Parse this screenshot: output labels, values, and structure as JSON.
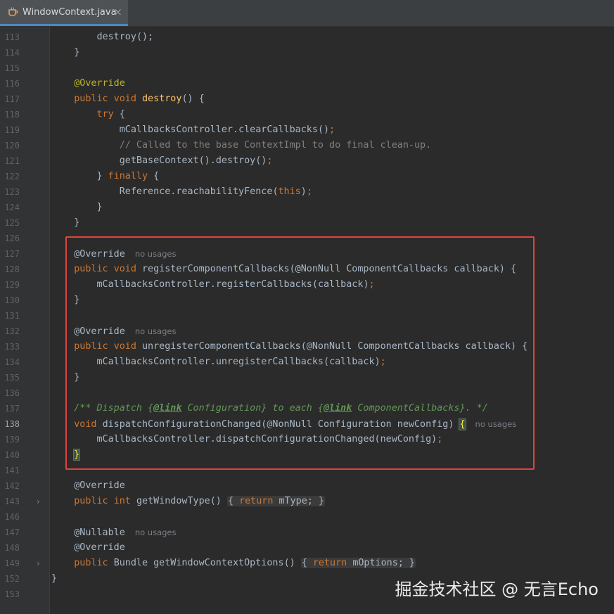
{
  "tab": {
    "title": "WindowContext.java",
    "close": "×"
  },
  "watermark": "掘金技术社区 @ 无言Echo",
  "hint_text": "no usages",
  "line_numbers": {
    "l113": "113",
    "l114": "114",
    "l115": "115",
    "l116": "116",
    "l117": "117",
    "l118": "118",
    "l119": "119",
    "l120": "120",
    "l121": "121",
    "l122": "122",
    "l123": "123",
    "l124": "124",
    "l125": "125",
    "l126": "126",
    "l127": "127",
    "l128": "128",
    "l129": "129",
    "l130": "130",
    "l131": "131",
    "l132": "132",
    "l133": "133",
    "l134": "134",
    "l135": "135",
    "l136": "136",
    "l137": "137",
    "l138": "138",
    "l139": "139",
    "l140": "140",
    "l141": "141",
    "l142": "142",
    "l143": "143",
    "l146": "146",
    "l147": "147",
    "l148": "148",
    "l149": "149",
    "l152": "152",
    "l153": "153"
  },
  "current_line": "138",
  "tokens": {
    "destroy_call": "destroy",
    "override": "@Override",
    "nullable": "@Nullable",
    "nonnull": "@NonNull",
    "public": "public",
    "void": "void",
    "int": "int",
    "try": "try",
    "finally": "finally",
    "return": "return",
    "this": "this",
    "destroy": "destroy",
    "mCallbacksController": "mCallbacksController",
    "clearCallbacks": "clearCallbacks",
    "comment_120": "// Called to the base ContextImpl to do final clean-up.",
    "getBaseContext": "getBaseContext",
    "Reference": "Reference",
    "reachabilityFence": "reachabilityFence",
    "registerComponentCallbacks": "registerComponentCallbacks",
    "unregisterComponentCallbacks": "unregisterComponentCallbacks",
    "ComponentCallbacks": "ComponentCallbacks",
    "callback": "callback",
    "registerCallbacks": "registerCallbacks",
    "unregisterCallbacks": "unregisterCallbacks",
    "doc_open": "/** Dispatch {",
    "doc_link": "@link",
    "doc_mid1": " Configuration} to each {",
    "doc_mid2": " ComponentCallbacks}. */",
    "dispatchConfigurationChanged": "dispatchConfigurationChanged",
    "Configuration": "Configuration",
    "newConfig": "newConfig",
    "getWindowType": "getWindowType",
    "mType": "mType",
    "Bundle": "Bundle",
    "getWindowContextOptions": "getWindowContextOptions",
    "mOptions": "mOptions"
  },
  "colors": {
    "background": "#2b2b2b",
    "keyword": "#cc7832",
    "annotation": "#bbb529",
    "method_decl": "#ffc66d",
    "comment": "#808080",
    "javadoc": "#629755",
    "highlight_box": "#e0443f"
  },
  "icons": {
    "tab_icon": "java-cup-icon",
    "fold_icon": "chevron-right-icon"
  }
}
